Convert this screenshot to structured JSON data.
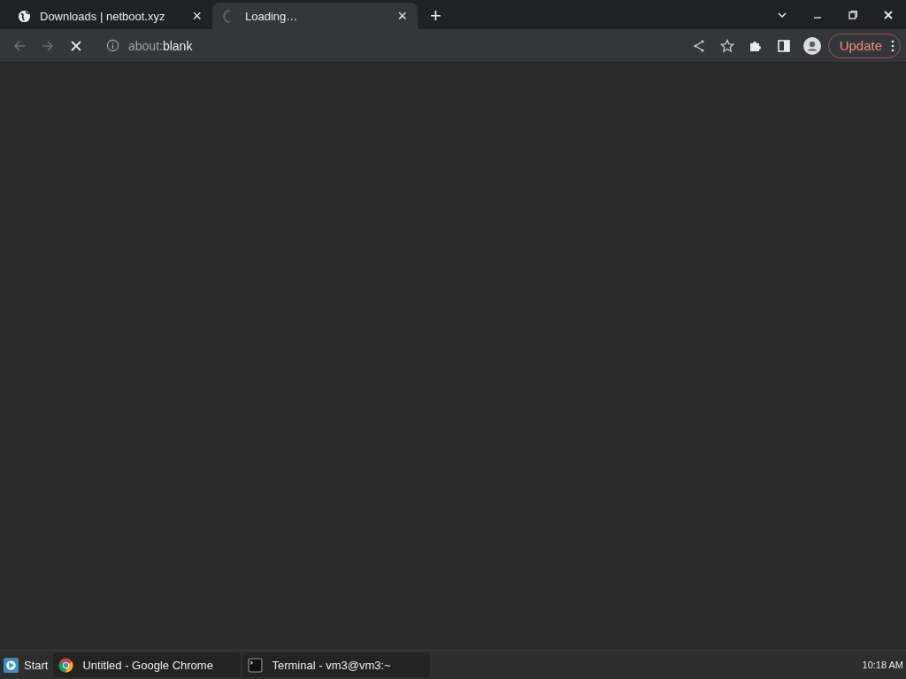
{
  "tabs": [
    {
      "title": "Downloads | netboot.xyz",
      "kind": "globe",
      "selected": false,
      "close": "×"
    },
    {
      "title": "Loading…",
      "kind": "spinner",
      "selected": true,
      "close": "×"
    }
  ],
  "new_tab": "+",
  "toolbar": {
    "loading": true,
    "address": {
      "scheme": "about:",
      "path": "blank"
    },
    "update_button": "Update"
  },
  "taskbar": {
    "start": "Start",
    "windows": [
      {
        "title": "Untitled - Google Chrome",
        "kind": "chrome"
      },
      {
        "title": "Terminal - vm3@vm3:~",
        "kind": "terminal"
      }
    ],
    "clock": "10:18 AM"
  }
}
